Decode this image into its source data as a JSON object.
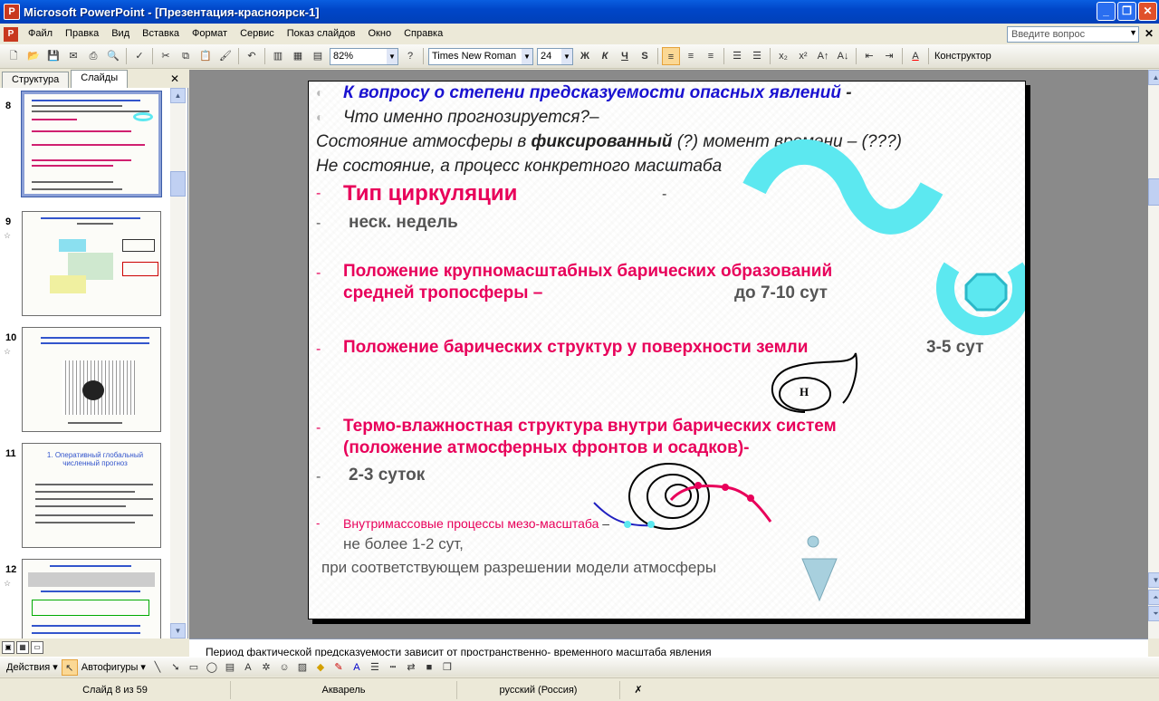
{
  "window": {
    "title": "Microsoft PowerPoint - [Презентация-красноярск-1]",
    "app_icon": "P"
  },
  "menu": {
    "items": [
      "Файл",
      "Правка",
      "Вид",
      "Вставка",
      "Формат",
      "Сервис",
      "Показ слайдов",
      "Окно",
      "Справка"
    ],
    "ask_placeholder": "Введите вопрос"
  },
  "toolbar": {
    "zoom": "82%",
    "font_name": "Times New Roman",
    "font_size": "24",
    "bold": "Ж",
    "italic": "К",
    "underline": "Ч",
    "shadow": "S",
    "designer": "Конструктор"
  },
  "left_pane": {
    "tabs": [
      "Структура",
      "Слайды"
    ],
    "thumbnails": [
      {
        "num": "8",
        "selected": true
      },
      {
        "num": "9"
      },
      {
        "num": "10"
      },
      {
        "num": "11",
        "title": "1. Оперативный глобальный численный прогноз"
      },
      {
        "num": "12"
      }
    ]
  },
  "slide": {
    "line1": "К вопросу о  степени предсказуемости   опасных явлений",
    "line1_dash": "-",
    "line2": "Что именно прогнозируется?–",
    "line3_a": "Состояние  атмосферы в ",
    "line3_b": "фиксированный",
    "line3_c": " (?) момент времени – (???)",
    "line4": "Не состояние, а процесс конкретного масштаба",
    "item1": "Тип циркуляции",
    "item1_dash": "-",
    "item1_sub": "неск. недель",
    "item2_l1": "Положение крупномасштабных барических образований",
    "item2_l2": "средней тропосферы  –",
    "item2_val": "до 7-10  сут",
    "item3": "Положение барических структур  у поверхности земли",
    "item3_val": "3-5 сут",
    "cyclone_label": "Н",
    "item4_l1": "Термо-влажностная структура внутри барических систем",
    "item4_l2": "(положение атмосферных фронтов и осадков)-",
    "item4_sub": "2-3 суток",
    "item5": "Внутримассовые процессы мезо-масштаба",
    "item5_dash": " –",
    "item5_sub": "не более 1-2 сут,",
    "item5_note": "при соответствующем разрешении модели атмосферы"
  },
  "notes": "Период фактической предсказуемости зависит от пространственно- временного масштаба явления",
  "drawing": {
    "actions": "Действия",
    "autoshapes": "Автофигуры"
  },
  "status": {
    "slide": "Слайд 8 из 59",
    "design": "Акварель",
    "language": "русский (Россия)"
  },
  "colors": {
    "accent_magenta": "#e8005a",
    "accent_blue": "#1a12d0",
    "cyan": "#5ce8f0",
    "titlebar": "#0a5ee0"
  }
}
